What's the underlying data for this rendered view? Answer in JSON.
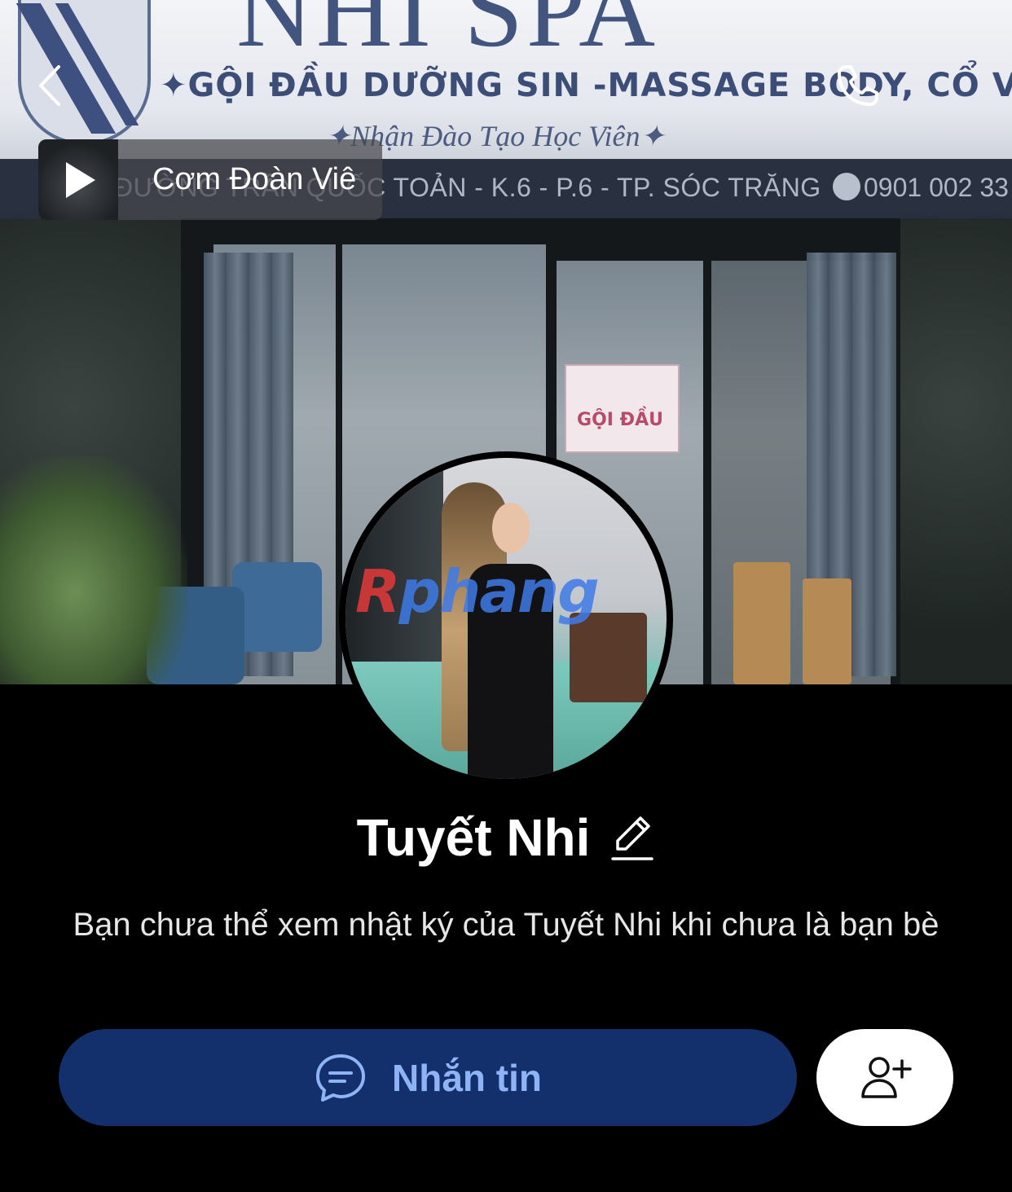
{
  "cover": {
    "sign_title": "NHI SPA",
    "sign_line1": "✦GỘI ĐẦU DƯỠNG SIN  -MASSAGE BODY, CỔ VAI GÁY",
    "sign_line2": "✦Nhận Đào Tạo Học Viên✦",
    "address_text": "ĐƯỜNG TRẦN QUỐC TOẢN - K.6 - P.6 - TP. SÓC TRĂNG",
    "address_phone": "0901 002 33",
    "poster_text": "GỘI ĐẦU"
  },
  "music": {
    "label": "Cơm Đoàn Viê"
  },
  "profile": {
    "name": "Tuyết Nhi",
    "notice": "Bạn chưa thể xem nhật ký của Tuyết Nhi khi chưa là bạn bè"
  },
  "avatar": {
    "watermark_r": "R",
    "watermark_rest": "phang"
  },
  "actions": {
    "message_label": "Nhắn tin"
  },
  "colors": {
    "background": "#000000",
    "message_button_bg": "#14306c",
    "message_button_text": "#8fb4f5",
    "add_friend_bg": "#ffffff"
  }
}
